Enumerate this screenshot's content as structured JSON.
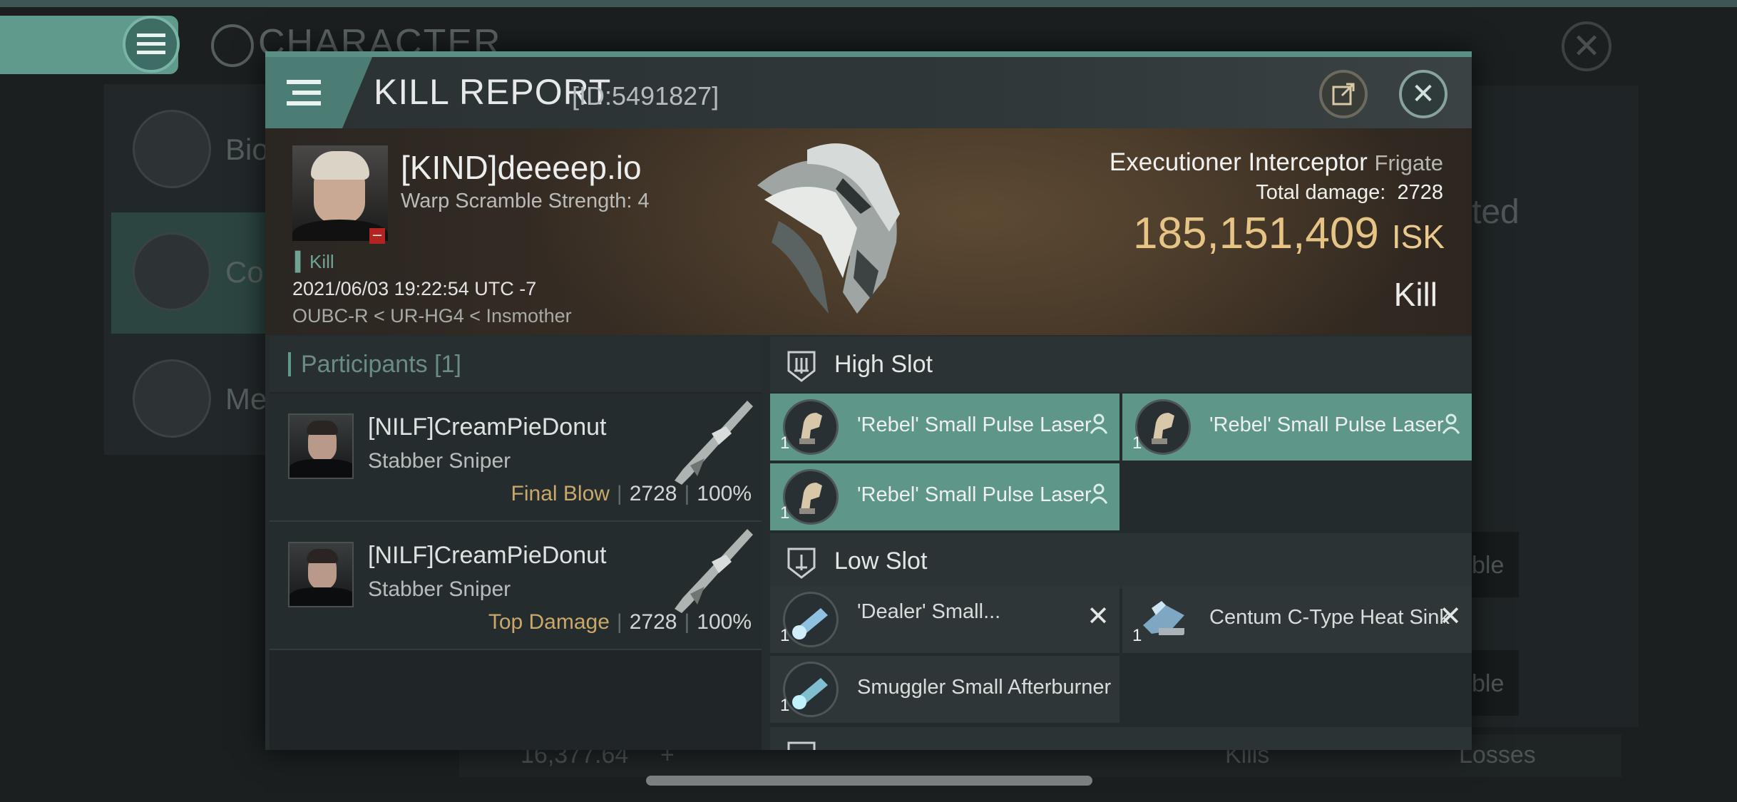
{
  "background": {
    "title": "CHARACTER",
    "left_items": [
      "Bio",
      "Co",
      "Me"
    ],
    "right_text": "ted",
    "right_buttons": [
      "ble",
      "ble"
    ],
    "bottom_value": "16,377.64",
    "bottom_plus": "+",
    "bottom_kills": "Kills",
    "bottom_losses": "Losses"
  },
  "header": {
    "title": "KILL REPORT",
    "id": "[ID:5491827]",
    "close_glyph": "✕"
  },
  "victim": {
    "name": "[KIND]deeeep.io",
    "warp": "Warp Scramble Strength: 4",
    "tag": "Kill",
    "datetime": "2021/06/03 19:22:54 UTC -7",
    "location": "OUBC-R < UR-HG4 < Insmother",
    "ship": "Executioner Interceptor",
    "ship_class": "Frigate",
    "damage_label": "Total damage:",
    "damage_value": "2728",
    "isk_value": "185,151,409",
    "isk_unit": "ISK",
    "result": "Kill"
  },
  "participants": {
    "label": "Participants",
    "count": "[1]",
    "rows": [
      {
        "name": "[NILF]CreamPieDonut",
        "ship": "Stabber Sniper",
        "role": "Final Blow",
        "damage": "2728",
        "percent": "100%"
      },
      {
        "name": "[NILF]CreamPieDonut",
        "ship": "Stabber Sniper",
        "role": "Top Damage",
        "damage": "2728",
        "percent": "100%"
      }
    ]
  },
  "fitting": {
    "high_slot": {
      "title": "High Slot",
      "modules": [
        {
          "name": "'Rebel' Small Pulse Laser",
          "qty": "1"
        },
        {
          "name": "'Rebel' Small Pulse Laser",
          "qty": "1"
        },
        {
          "name": "'Rebel' Small Pulse Laser",
          "qty": "1"
        }
      ]
    },
    "low_slot": {
      "title": "Low Slot",
      "modules": [
        {
          "name": "'Dealer' Small...",
          "qty": "1"
        },
        {
          "name": "Centum C-Type Heat Sink",
          "qty": "1"
        },
        {
          "name": "Smuggler Small Afterburner",
          "qty": "1"
        }
      ]
    },
    "destroyed_glyph": "✕"
  },
  "colors": {
    "accent": "#5e978a",
    "isk": "#e6c485",
    "final_blow": "#c9a86a",
    "destroyed_badge": "#b3231f"
  }
}
